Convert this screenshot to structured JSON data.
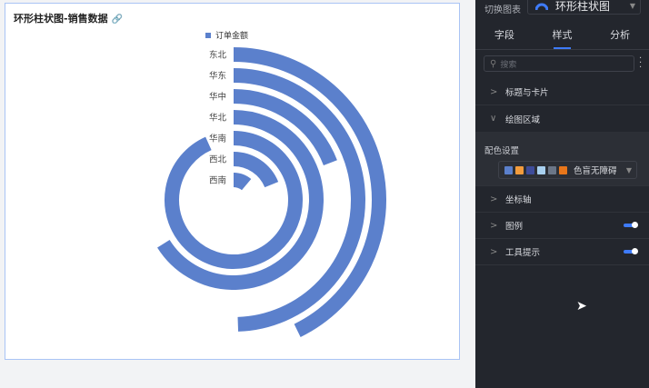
{
  "card": {
    "title": "环形柱状图-销售数据",
    "link_icon": "link-icon"
  },
  "chart_data": {
    "type": "radial-bar",
    "title": "环形柱状图-销售数据",
    "legend": [
      "订单金额"
    ],
    "legend_position": "top",
    "color": "#5b80cc",
    "angle_max": 360,
    "categories": [
      "东北",
      "华东",
      "华中",
      "华北",
      "华南",
      "西北",
      "西南"
    ],
    "series": [
      {
        "name": "订单金额",
        "values": [
          154,
          178,
          69,
          238,
          336,
          68,
          40
        ]
      }
    ]
  },
  "panel": {
    "switch_label": "切换图表",
    "chart_type": "环形柱状图",
    "tabs": [
      "字段",
      "样式",
      "分析"
    ],
    "search_placeholder": "搜索",
    "sections": [
      "标题与卡片",
      "绘图区域",
      "坐标轴",
      "图例",
      "工具提示"
    ],
    "color_label": "配色设置",
    "palette_name": "色盲无障碍",
    "palette": [
      "#5b80cc",
      "#f39c3d",
      "#3e4c9a",
      "#a8d0ef",
      "#6b7687",
      "#e8761a"
    ],
    "legend_toggle": true,
    "tooltip_toggle": true
  }
}
